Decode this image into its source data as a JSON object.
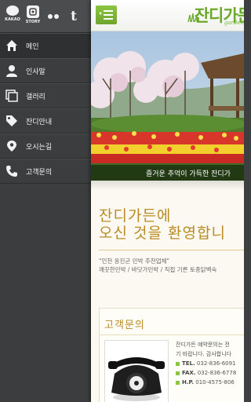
{
  "social": {
    "kakao_label": "KAKAO",
    "story_label": "STORY",
    "tumblr_glyph": "t"
  },
  "menu": {
    "items": [
      {
        "label": "메인",
        "icon": "home-icon"
      },
      {
        "label": "인사말",
        "icon": "person-icon"
      },
      {
        "label": "갤러리",
        "icon": "gallery-icon"
      },
      {
        "label": "잔디안내",
        "icon": "tag-icon"
      },
      {
        "label": "오시는길",
        "icon": "location-pin-icon"
      },
      {
        "label": "고객문의",
        "icon": "phone-icon"
      }
    ]
  },
  "header": {
    "logo_text": "잔디가든",
    "logo_sub": "garden"
  },
  "hero": {
    "caption": "즐거운 추억이 가득한 잔디가"
  },
  "welcome": {
    "line1": "잔디가든에",
    "line2": "오신 것을 환영합니",
    "desc1": "\"인천 옹진군 민박 추천업체\"",
    "desc2": "깨끗한민박 / 바닷가민박 / 직접 기른 토종닭백숙"
  },
  "contact": {
    "title": "고객문의",
    "intro1": "잔디가든 예약문의는 전",
    "intro2": "기 바랍니다. 감사합니다",
    "tel_label": "TEL.",
    "tel": "032-836-6091",
    "fax_label": "FAX.",
    "fax": "032-836-6778",
    "hp_label": "H.P.",
    "hp": "010-4575-806"
  },
  "colors": {
    "accent_green": "#6fa52c",
    "title_gold": "#b88b23",
    "sidebar_bg": "#3b3d3f"
  }
}
